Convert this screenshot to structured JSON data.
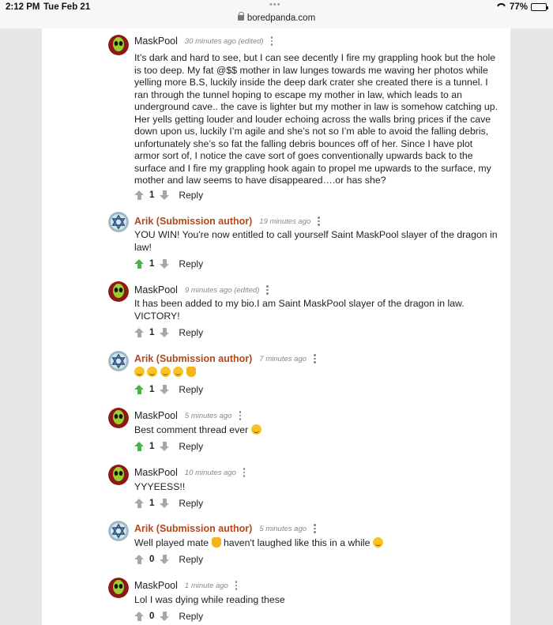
{
  "status_bar": {
    "time": "2:12 PM",
    "date": "Tue Feb 21",
    "url": "boredpanda.com",
    "battery": "77%",
    "battery_level": 0.77
  },
  "reply_label": "Reply",
  "comments": [
    {
      "author": "MaskPool",
      "is_op": false,
      "time": "30 minutes ago",
      "edited": "(edited)",
      "text": "It’s dark and hard to see, but I can see decently I fire my grappling hook but the hole is too deep. My fat @$$ mother in law lunges towards me waving her photos while yelling more B.S, luckily inside the deep dark crater she created there is a tunnel. I ran through the tunnel hoping to escape my mother in law, which leads to an underground cave.. the cave is lighter but my mother in law is somehow catching up. Her yells getting louder and louder echoing across the walls bring prices if the cave down upon us, luckily I’m agile and she’s not so I’m able to avoid the falling debris, unfortunately she’s so fat the falling debris bounces off of her. Since I have plot armor sort of, I notice the cave sort of goes conventionally upwards back to the surface and I fire my grappling hook again to propel me upwards to the surface, my mother and law seems to have disappeared….or has she?",
      "votes": "1",
      "upvoted": false
    },
    {
      "author": "Arik (Submission author)",
      "is_op": true,
      "time": "19 minutes ago",
      "edited": "",
      "text": "YOU WIN! You're now entitled to call yourself Saint MaskPool slayer of the dragon in law!",
      "votes": "1",
      "upvoted": true
    },
    {
      "author": "MaskPool",
      "is_op": false,
      "time": "9 minutes ago",
      "edited": "(edited)",
      "text": "It has been added to my bio.I am Saint MaskPool slayer of the dragon in law. VICTORY!",
      "votes": "1",
      "upvoted": false
    },
    {
      "author": "Arik (Submission author)",
      "is_op": true,
      "time": "7 minutes ago",
      "edited": "",
      "text": "",
      "emojis": [
        "laughing-face",
        "laughing-face",
        "laughing-face",
        "laughing-face",
        "thumbs-up"
      ],
      "votes": "1",
      "upvoted": true
    },
    {
      "author": "MaskPool",
      "is_op": false,
      "time": "5 minutes ago",
      "edited": "",
      "text": "Best comment thread ever",
      "emojis_after": [
        "laughing-face"
      ],
      "votes": "1",
      "upvoted": true
    },
    {
      "author": "MaskPool",
      "is_op": false,
      "time": "10 minutes ago",
      "edited": "",
      "text": "YYYEESS!!",
      "votes": "1",
      "upvoted": false
    },
    {
      "author": "Arik (Submission author)",
      "is_op": true,
      "time": "5 minutes ago",
      "edited": "",
      "text_parts": [
        "Well played mate",
        "haven't laughed like this in a while"
      ],
      "votes": "0",
      "upvoted": false
    },
    {
      "author": "MaskPool",
      "is_op": false,
      "time": "1 minute ago",
      "edited": "",
      "text": "Lol I was dying while reading these",
      "votes": "0",
      "upvoted": false
    }
  ]
}
